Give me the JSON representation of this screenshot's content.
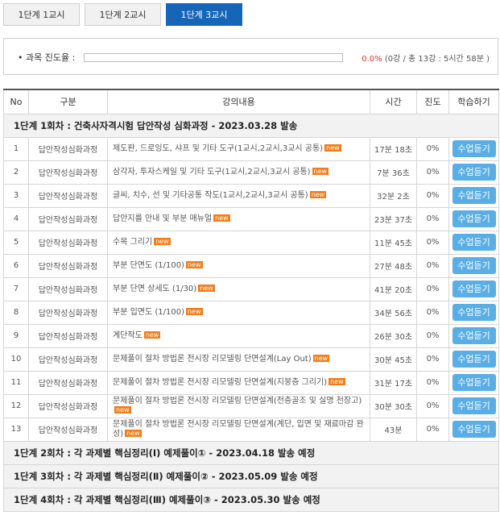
{
  "tabs": [
    {
      "label": "1단계 1교시",
      "active": false
    },
    {
      "label": "1단계 2교시",
      "active": false
    },
    {
      "label": "1단계 3교시",
      "active": true
    }
  ],
  "progress": {
    "label": "• 과목 진도율 :",
    "percent_text": "0.0%",
    "detail": "(0강 / 총 13강 : 5시간 58분 )",
    "fraction": 0.0
  },
  "table": {
    "headers": [
      "No",
      "구분",
      "강의내용",
      "시간",
      "진도",
      "학습하기"
    ],
    "section1": "1단계 1회차 : 건축사자격시험 답안작성 심화과정 - 2023.03.28 발송",
    "rows": [
      {
        "no": "1",
        "cat": "답안작성심화과정",
        "content": "제도판, 드로잉도, 샤프 및 기타 도구(1교시,2교시,3교시 공통)",
        "time": "17분 18초",
        "progress": "0%",
        "button": "수업듣기",
        "new": "new"
      },
      {
        "no": "2",
        "cat": "답안작성심화과정",
        "content": "삼각자, 투자스케일 및 기타 도구(1교시,2교시,3교시 공통)",
        "time": "7분 36초",
        "progress": "0%",
        "button": "수업듣기",
        "new": "new"
      },
      {
        "no": "3",
        "cat": "답안작성심화과정",
        "content": "글씨, 치수, 선 및 기타공통 작도(1교시,2교시,3교시 공통)",
        "time": "32분 2초",
        "progress": "0%",
        "button": "수업듣기",
        "new": "new"
      },
      {
        "no": "4",
        "cat": "답안작성심화과정",
        "content": "답안지를 안내 및 부분 매뉴얼",
        "time": "23분 37초",
        "progress": "0%",
        "button": "수업듣기",
        "new": "new"
      },
      {
        "no": "5",
        "cat": "답안작성심화과정",
        "content": "수목 그리기",
        "time": "11분 45초",
        "progress": "0%",
        "button": "수업듣기",
        "new": "new"
      },
      {
        "no": "6",
        "cat": "답안작성심화과정",
        "content": "부분 단면도 (1/100)",
        "time": "27분 48초",
        "progress": "0%",
        "button": "수업듣기",
        "new": "new"
      },
      {
        "no": "7",
        "cat": "답안작성심화과정",
        "content": "부분 단면 상세도 (1/30)",
        "time": "41분 20초",
        "progress": "0%",
        "button": "수업듣기",
        "new": "new"
      },
      {
        "no": "8",
        "cat": "답안작성심화과정",
        "content": "부분 입면도 (1/100)",
        "time": "34분 56초",
        "progress": "0%",
        "button": "수업듣기",
        "new": "new"
      },
      {
        "no": "9",
        "cat": "답안작성심화과정",
        "content": "계단작도",
        "time": "26분 30초",
        "progress": "0%",
        "button": "수업듣기",
        "new": "new"
      },
      {
        "no": "10",
        "cat": "답안작성심화과정",
        "content": "문제풀이 절차 방법론 전시장 리모델링 단면설계(Lay Out)",
        "time": "30분 45초",
        "progress": "0%",
        "button": "수업듣기",
        "new": "new"
      },
      {
        "no": "11",
        "cat": "답안작성심화과정",
        "content": "문제풀이 절차 방법론 전시장 리모델링 단면설계(지붕층 그리기)",
        "time": "31분 17초",
        "progress": "0%",
        "button": "수업듣기",
        "new": "new"
      },
      {
        "no": "12",
        "cat": "답안작성심화과정",
        "content": "문제풀이 절차 방법론 전시장 리모델링 단면설계(전층골조 및 실명 천장고)",
        "time": "30분 30초",
        "progress": "0%",
        "button": "수업듣기",
        "new": "new"
      },
      {
        "no": "13",
        "cat": "답안작성심화과정",
        "content": "문제풀이 절차 방법론 전시장 리모델링 단면설계(계단, 입면 및 재료마감 완성)",
        "time": "43분",
        "progress": "0%",
        "button": "수업듣기",
        "new": "new"
      }
    ],
    "section2": "1단계 2회차 : 각 과제별 핵심정리(Ⅰ) 예제풀이① - 2023.04.18 발송 예정",
    "section3": "1단계 3회차 : 각 과제별 핵심정리(Ⅱ) 예제풀이② - 2023.05.09 발송 예정",
    "section4": "1단계 4회차 : 각 과제별 핵심정리(Ⅲ) 예제풀이③ - 2023.05.30 발송 예정"
  },
  "colors": {
    "accent": "#1565b8",
    "button": "#5aaee6",
    "new_badge": "#f07d1a",
    "percent": "#e03030"
  }
}
